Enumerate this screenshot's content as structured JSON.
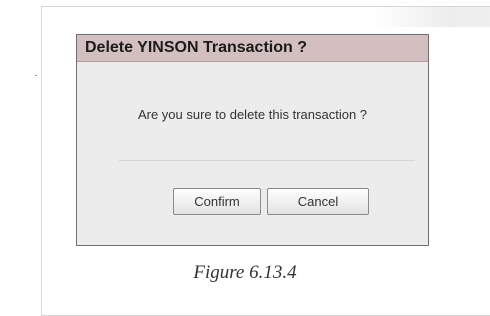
{
  "dialog": {
    "title": "Delete YINSON Transaction ?",
    "message": "Are you sure to delete this transaction ?",
    "confirm_label": "Confirm",
    "cancel_label": "Cancel"
  },
  "caption": "Figure 6.13.4",
  "colors": {
    "titlebar": "#d3bfbf",
    "dialog_background": "#ececec",
    "dialog_border": "#6f6f6f"
  }
}
